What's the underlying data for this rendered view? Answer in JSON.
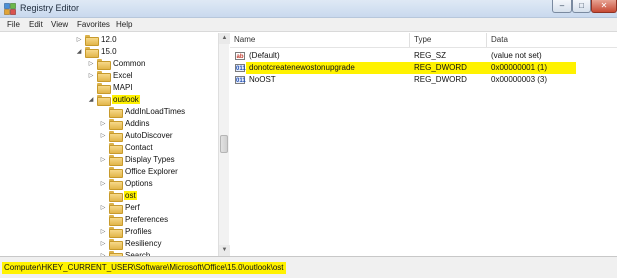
{
  "window": {
    "title": "Registry Editor",
    "controls": {
      "minimize": "–",
      "maximize": "□",
      "close": "✕"
    }
  },
  "menu": [
    "File",
    "Edit",
    "View",
    "Favorites",
    "Help"
  ],
  "tree": [
    {
      "label": "12.0",
      "arrow": "▷",
      "highlighted": false
    },
    {
      "label": "15.0",
      "arrow": "◢",
      "highlighted": false
    },
    {
      "label": "Common",
      "arrow": "▷",
      "highlighted": false
    },
    {
      "label": "Excel",
      "arrow": "▷",
      "highlighted": false
    },
    {
      "label": "MAPI",
      "arrow": "",
      "highlighted": false
    },
    {
      "label": "outlook",
      "arrow": "◢",
      "highlighted": true
    },
    {
      "label": "AddInLoadTimes",
      "arrow": "",
      "highlighted": false
    },
    {
      "label": "Addins",
      "arrow": "▷",
      "highlighted": false
    },
    {
      "label": "AutoDiscover",
      "arrow": "▷",
      "highlighted": false
    },
    {
      "label": "Contact",
      "arrow": "",
      "highlighted": false
    },
    {
      "label": "Display Types",
      "arrow": "▷",
      "highlighted": false
    },
    {
      "label": "Office Explorer",
      "arrow": "",
      "highlighted": false
    },
    {
      "label": "Options",
      "arrow": "▷",
      "highlighted": false
    },
    {
      "label": "ost",
      "arrow": "",
      "highlighted": true
    },
    {
      "label": "Perf",
      "arrow": "▷",
      "highlighted": false
    },
    {
      "label": "Preferences",
      "arrow": "",
      "highlighted": false
    },
    {
      "label": "Profiles",
      "arrow": "▷",
      "highlighted": false
    },
    {
      "label": "Resiliency",
      "arrow": "▷",
      "highlighted": false
    },
    {
      "label": "Search",
      "arrow": "▷",
      "highlighted": false
    }
  ],
  "scrollbar": {
    "up": "▲",
    "down": "▼"
  },
  "list": {
    "columns": [
      "Name",
      "Type",
      "Data"
    ],
    "rows": [
      {
        "icon": "ab",
        "icon_name": "string-value-icon",
        "name": "(Default)",
        "type": "REG_SZ",
        "data": "(value not set)",
        "highlighted": false
      },
      {
        "icon": "011",
        "icon_name": "dword-value-icon",
        "name": "donotcreatenewostonupgrade",
        "type": "REG_DWORD",
        "data": "0x00000001 (1)",
        "highlighted": true
      },
      {
        "icon": "011",
        "icon_name": "dword-value-icon",
        "name": "NoOST",
        "type": "REG_DWORD",
        "data": "0x00000003 (3)",
        "highlighted": false
      }
    ]
  },
  "status": {
    "path": "Computer\\HKEY_CURRENT_USER\\Software\\Microsoft\\Office\\15.0\\outlook\\ost"
  },
  "colors": {
    "highlight": "#fff200",
    "titlebar": "#c9d9ee",
    "folder": "#e2b64a"
  }
}
